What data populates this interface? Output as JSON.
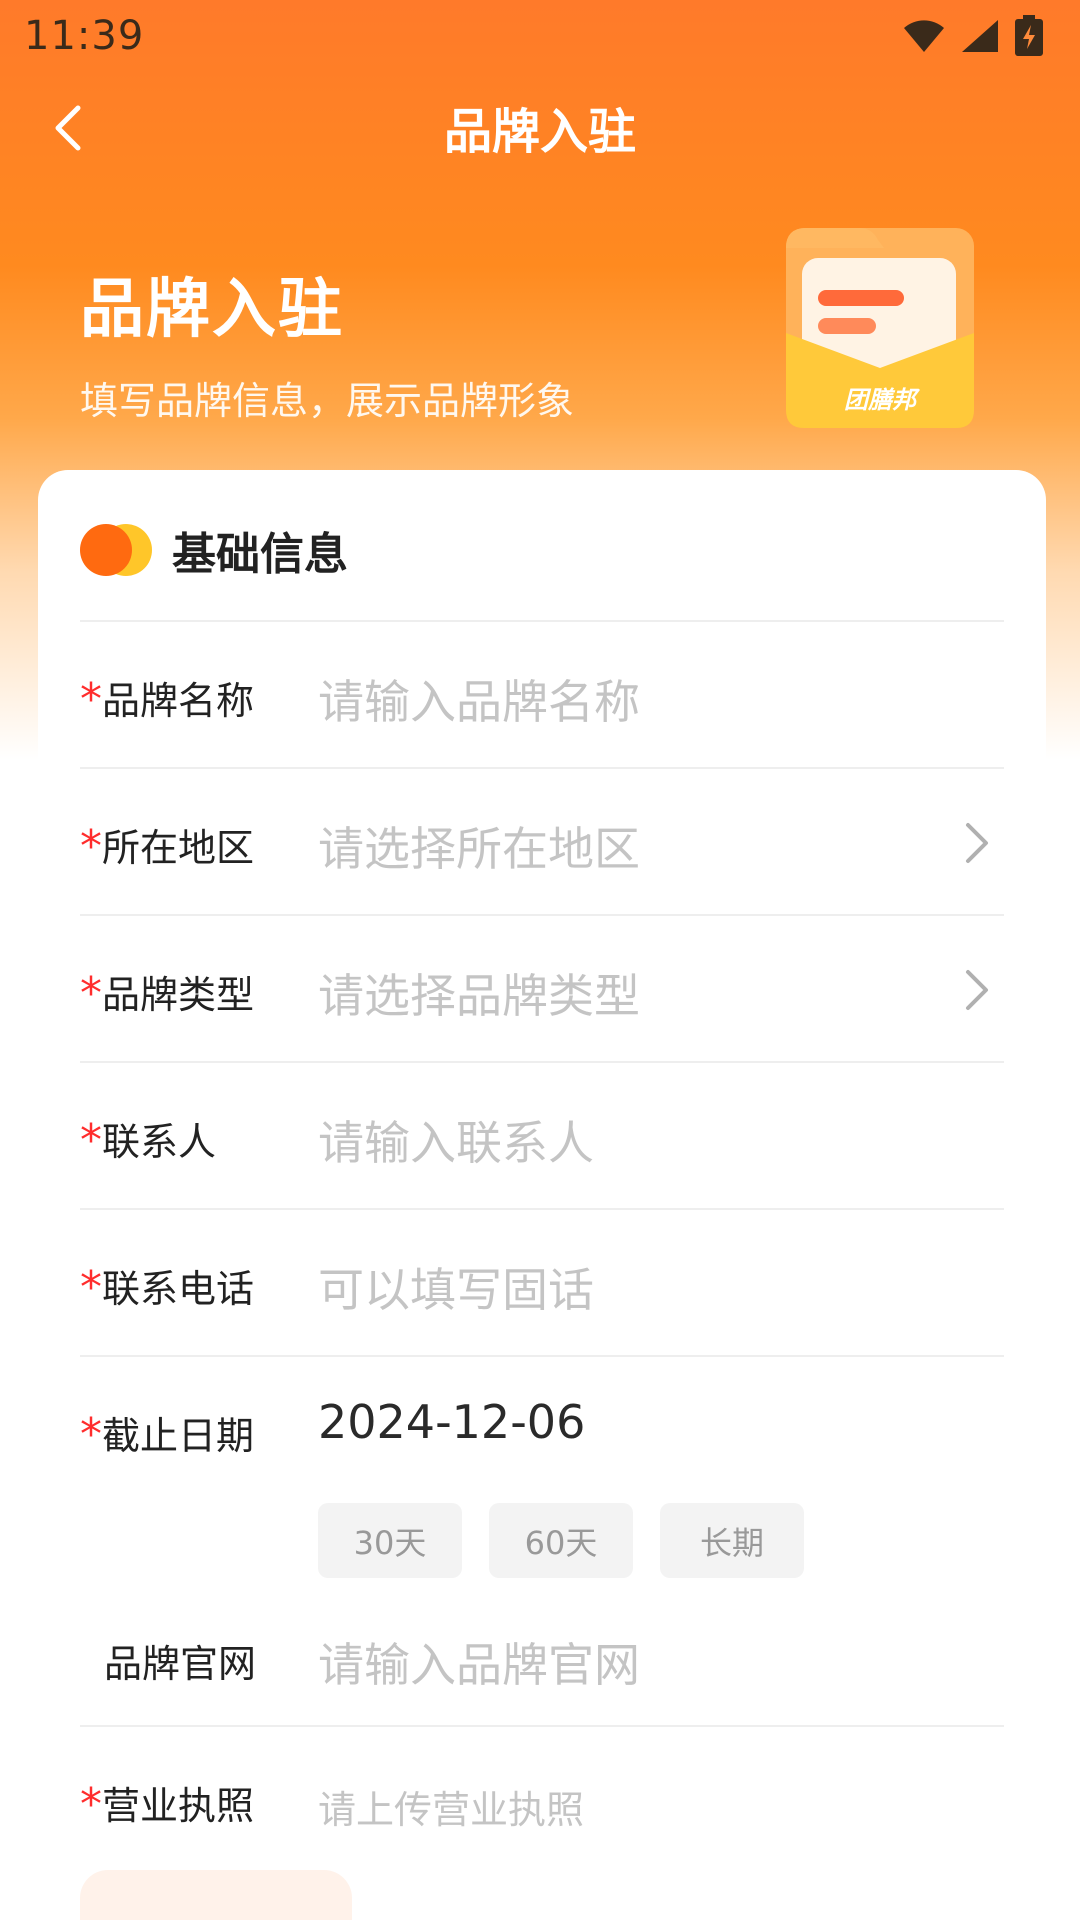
{
  "status_bar": {
    "time": "11:39"
  },
  "nav": {
    "title": "品牌入驻"
  },
  "hero": {
    "title": "品牌入驻",
    "subtitle": "填写品牌信息，展示品牌形象",
    "logo_text": "团膳邦"
  },
  "section": {
    "title": "基础信息"
  },
  "form": {
    "required_mark": "*",
    "brand_name": {
      "label": "品牌名称",
      "placeholder": "请输入品牌名称"
    },
    "region": {
      "label": "所在地区",
      "placeholder": "请选择所在地区"
    },
    "brand_type": {
      "label": "品牌类型",
      "placeholder": "请选择品牌类型"
    },
    "contact": {
      "label": "联系人",
      "placeholder": "请输入联系人"
    },
    "phone": {
      "label": "联系电话",
      "placeholder": "可以填写固话"
    },
    "deadline": {
      "label": "截止日期",
      "value": "2024-12-06",
      "options": [
        "30天",
        "60天",
        "长期"
      ]
    },
    "website": {
      "label": "品牌官网",
      "placeholder": "请输入品牌官网"
    },
    "license": {
      "label": "营业执照",
      "hint": "请上传营业执照"
    }
  },
  "colors": {
    "primary": "#ff7a2a",
    "required": "#ff2d2d",
    "placeholder": "#c4c4c4"
  }
}
